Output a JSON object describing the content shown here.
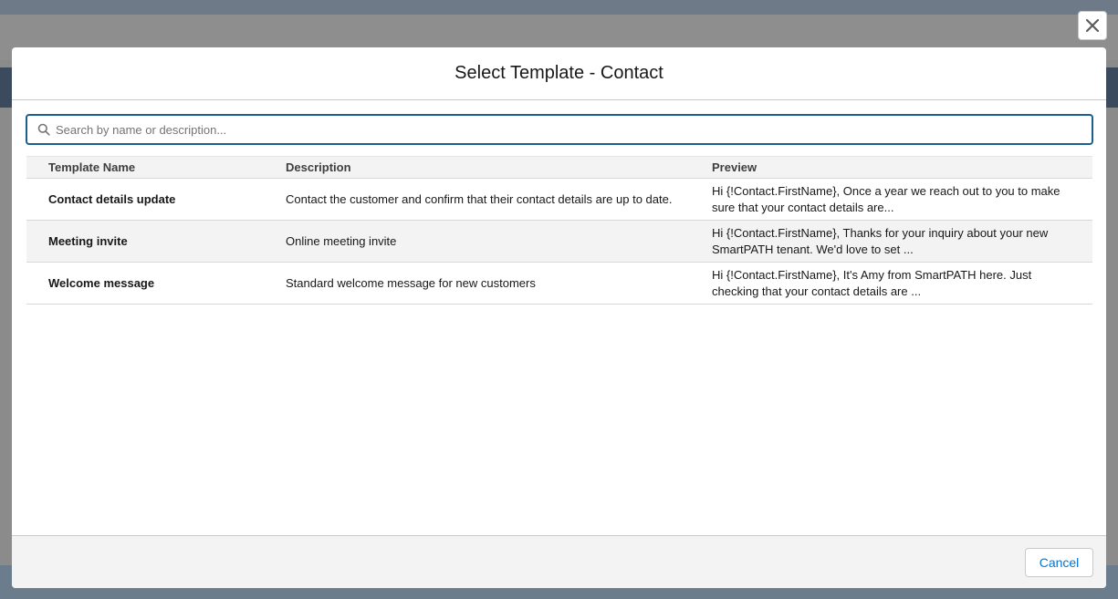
{
  "modal": {
    "title": "Select Template - Contact",
    "close_icon": "close-icon"
  },
  "search": {
    "placeholder": "Search by name or description...",
    "value": "",
    "icon": "search-icon"
  },
  "table": {
    "columns": [
      "Template Name",
      "Description",
      "Preview"
    ],
    "rows": [
      {
        "name": "Contact details update",
        "description": "Contact the customer and confirm that their contact details are up to date.",
        "preview": "Hi {!Contact.FirstName}, Once a year we reach out to you to make sure that your contact details are..."
      },
      {
        "name": "Meeting invite",
        "description": "Online meeting invite",
        "preview": "Hi {!Contact.FirstName}, Thanks for your inquiry about your new SmartPATH tenant. We'd love to set ..."
      },
      {
        "name": "Welcome message",
        "description": "Standard welcome message for new customers",
        "preview": "Hi {!Contact.FirstName}, It's Amy from SmartPATH here. Just checking that your contact details are ..."
      }
    ]
  },
  "footer": {
    "cancel_label": "Cancel"
  },
  "colors": {
    "accent": "#0176d3",
    "focus_border": "#1b5f8f"
  }
}
